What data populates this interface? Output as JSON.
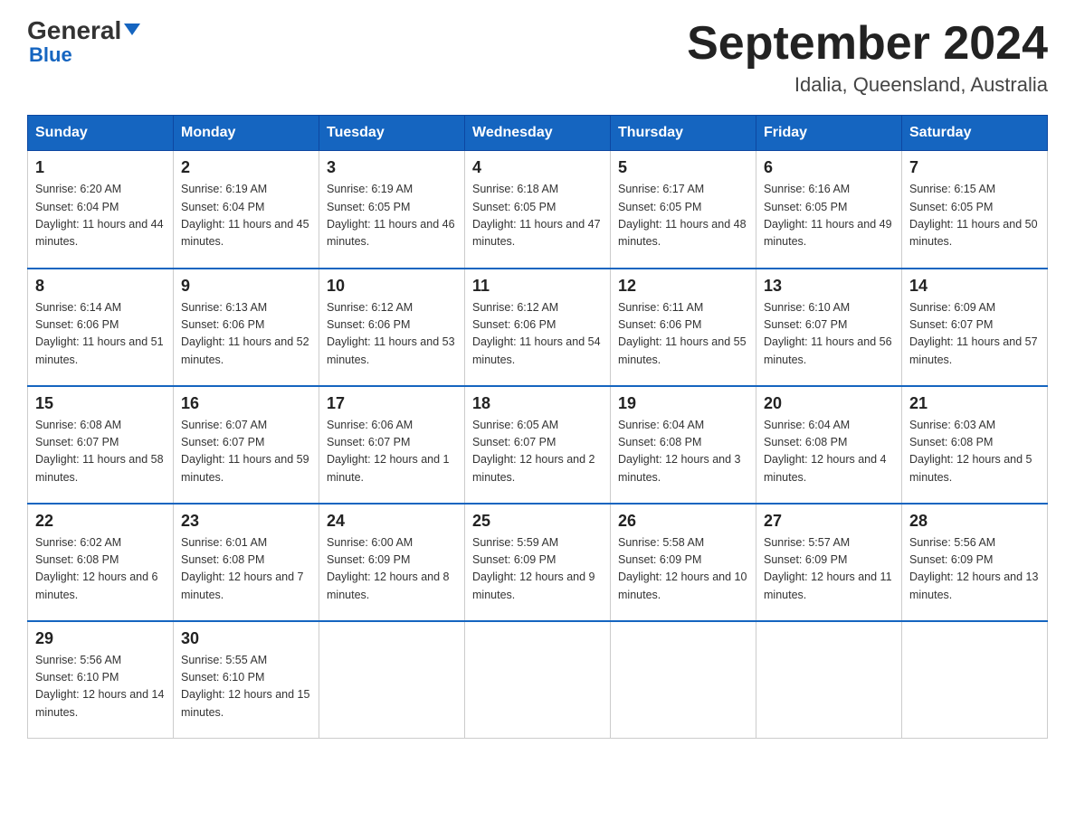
{
  "header": {
    "logo_general": "General",
    "logo_blue": "Blue",
    "title": "September 2024",
    "subtitle": "Idalia, Queensland, Australia"
  },
  "days_of_week": [
    "Sunday",
    "Monday",
    "Tuesday",
    "Wednesday",
    "Thursday",
    "Friday",
    "Saturday"
  ],
  "weeks": [
    [
      {
        "day": "1",
        "sunrise": "6:20 AM",
        "sunset": "6:04 PM",
        "daylight": "11 hours and 44 minutes."
      },
      {
        "day": "2",
        "sunrise": "6:19 AM",
        "sunset": "6:04 PM",
        "daylight": "11 hours and 45 minutes."
      },
      {
        "day": "3",
        "sunrise": "6:19 AM",
        "sunset": "6:05 PM",
        "daylight": "11 hours and 46 minutes."
      },
      {
        "day": "4",
        "sunrise": "6:18 AM",
        "sunset": "6:05 PM",
        "daylight": "11 hours and 47 minutes."
      },
      {
        "day": "5",
        "sunrise": "6:17 AM",
        "sunset": "6:05 PM",
        "daylight": "11 hours and 48 minutes."
      },
      {
        "day": "6",
        "sunrise": "6:16 AM",
        "sunset": "6:05 PM",
        "daylight": "11 hours and 49 minutes."
      },
      {
        "day": "7",
        "sunrise": "6:15 AM",
        "sunset": "6:05 PM",
        "daylight": "11 hours and 50 minutes."
      }
    ],
    [
      {
        "day": "8",
        "sunrise": "6:14 AM",
        "sunset": "6:06 PM",
        "daylight": "11 hours and 51 minutes."
      },
      {
        "day": "9",
        "sunrise": "6:13 AM",
        "sunset": "6:06 PM",
        "daylight": "11 hours and 52 minutes."
      },
      {
        "day": "10",
        "sunrise": "6:12 AM",
        "sunset": "6:06 PM",
        "daylight": "11 hours and 53 minutes."
      },
      {
        "day": "11",
        "sunrise": "6:12 AM",
        "sunset": "6:06 PM",
        "daylight": "11 hours and 54 minutes."
      },
      {
        "day": "12",
        "sunrise": "6:11 AM",
        "sunset": "6:06 PM",
        "daylight": "11 hours and 55 minutes."
      },
      {
        "day": "13",
        "sunrise": "6:10 AM",
        "sunset": "6:07 PM",
        "daylight": "11 hours and 56 minutes."
      },
      {
        "day": "14",
        "sunrise": "6:09 AM",
        "sunset": "6:07 PM",
        "daylight": "11 hours and 57 minutes."
      }
    ],
    [
      {
        "day": "15",
        "sunrise": "6:08 AM",
        "sunset": "6:07 PM",
        "daylight": "11 hours and 58 minutes."
      },
      {
        "day": "16",
        "sunrise": "6:07 AM",
        "sunset": "6:07 PM",
        "daylight": "11 hours and 59 minutes."
      },
      {
        "day": "17",
        "sunrise": "6:06 AM",
        "sunset": "6:07 PM",
        "daylight": "12 hours and 1 minute."
      },
      {
        "day": "18",
        "sunrise": "6:05 AM",
        "sunset": "6:07 PM",
        "daylight": "12 hours and 2 minutes."
      },
      {
        "day": "19",
        "sunrise": "6:04 AM",
        "sunset": "6:08 PM",
        "daylight": "12 hours and 3 minutes."
      },
      {
        "day": "20",
        "sunrise": "6:04 AM",
        "sunset": "6:08 PM",
        "daylight": "12 hours and 4 minutes."
      },
      {
        "day": "21",
        "sunrise": "6:03 AM",
        "sunset": "6:08 PM",
        "daylight": "12 hours and 5 minutes."
      }
    ],
    [
      {
        "day": "22",
        "sunrise": "6:02 AM",
        "sunset": "6:08 PM",
        "daylight": "12 hours and 6 minutes."
      },
      {
        "day": "23",
        "sunrise": "6:01 AM",
        "sunset": "6:08 PM",
        "daylight": "12 hours and 7 minutes."
      },
      {
        "day": "24",
        "sunrise": "6:00 AM",
        "sunset": "6:09 PM",
        "daylight": "12 hours and 8 minutes."
      },
      {
        "day": "25",
        "sunrise": "5:59 AM",
        "sunset": "6:09 PM",
        "daylight": "12 hours and 9 minutes."
      },
      {
        "day": "26",
        "sunrise": "5:58 AM",
        "sunset": "6:09 PM",
        "daylight": "12 hours and 10 minutes."
      },
      {
        "day": "27",
        "sunrise": "5:57 AM",
        "sunset": "6:09 PM",
        "daylight": "12 hours and 11 minutes."
      },
      {
        "day": "28",
        "sunrise": "5:56 AM",
        "sunset": "6:09 PM",
        "daylight": "12 hours and 13 minutes."
      }
    ],
    [
      {
        "day": "29",
        "sunrise": "5:56 AM",
        "sunset": "6:10 PM",
        "daylight": "12 hours and 14 minutes."
      },
      {
        "day": "30",
        "sunrise": "5:55 AM",
        "sunset": "6:10 PM",
        "daylight": "12 hours and 15 minutes."
      },
      null,
      null,
      null,
      null,
      null
    ]
  ],
  "labels": {
    "sunrise_prefix": "Sunrise: ",
    "sunset_prefix": "Sunset: ",
    "daylight_prefix": "Daylight: "
  }
}
